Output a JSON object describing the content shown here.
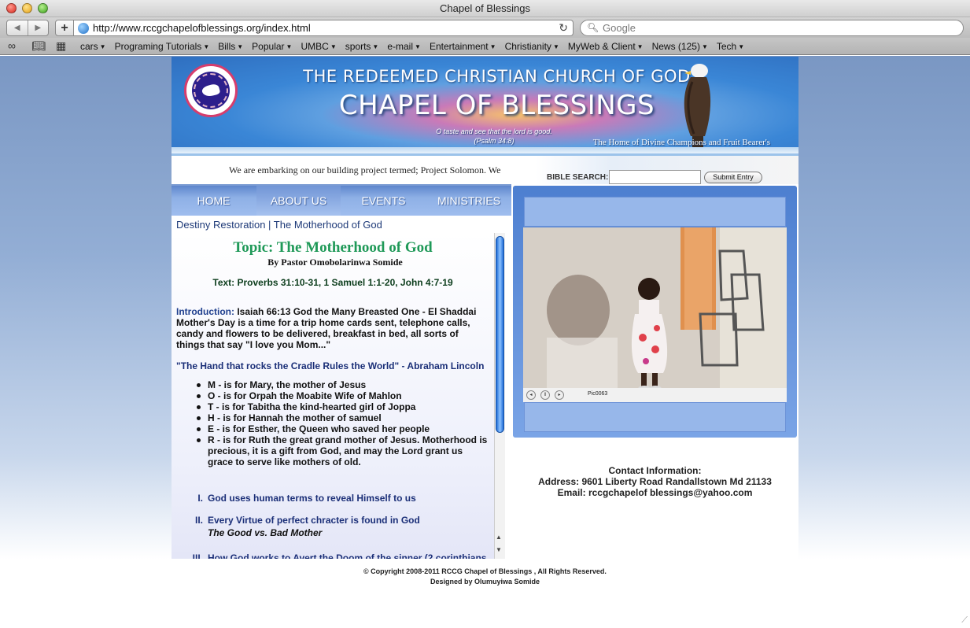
{
  "window": {
    "title": "Chapel of Blessings"
  },
  "toolbar": {
    "url": "http://www.rccgchapelofblessings.org/index.html",
    "search_placeholder": "Google"
  },
  "bookmarks": [
    {
      "label": "cars"
    },
    {
      "label": "Programing Tutorials"
    },
    {
      "label": "Bills"
    },
    {
      "label": "Popular"
    },
    {
      "label": "UMBC"
    },
    {
      "label": "sports"
    },
    {
      "label": "e-mail"
    },
    {
      "label": "Entertainment"
    },
    {
      "label": "Christianity"
    },
    {
      "label": "MyWeb & Client"
    },
    {
      "label": "News (125)"
    },
    {
      "label": "Tech"
    }
  ],
  "banner": {
    "logo_text": "THE REDEEMED CHRISTIAN CHURCH OF GOD",
    "church": "THE REDEEMED CHRISTIAN CHURCH OF GOD",
    "chapel": "CHAPEL OF BLESSINGS",
    "verse_line1": "O taste and see that the lord is good.",
    "verse_line2": "(Psalm 34:8)",
    "tagline": "The Home of Divine Champions and Fruit Bearer's"
  },
  "announcement": "We are embarking on our building project termed; Project Solomon. We",
  "bible_search": {
    "label": "BIBLE SEARCH:",
    "value": "",
    "button": "Submit Entry"
  },
  "nav": [
    {
      "label": "HOME",
      "active": false
    },
    {
      "label": "ABOUT US",
      "active": true
    },
    {
      "label": "EVENTS",
      "active": false
    },
    {
      "label": "MINISTRIES",
      "active": false
    }
  ],
  "breadcrumb": "Destiny Restoration | The Motherhood of God",
  "article": {
    "topic": "Topic: The Motherhood of God",
    "pastor": "By Pastor Omobolarinwa Somide",
    "text": "Text: Proverbs 31:10-31, 1 Samuel 1:1-20, John 4:7-19",
    "intro_lead": "Introduction:",
    "intro_body": " Isaiah 66:13 God the Many Breasted One - El Shaddai Mother's Day is a time for a trip home cards sent, telephone calls, candy and flowers to be delivered, breakfast in bed, all sorts of things that say \"I love you Mom...\"",
    "quote": "\"The Hand that rocks the Cradle Rules the World\" - Abraham Lincoln",
    "bullets": [
      "M - is for Mary, the mother of Jesus",
      "O - is for Orpah the Moabite Wife of Mahlon",
      "T - is for Tabitha the kind-hearted girl of Joppa",
      "H - is for Hannah the mother of samuel",
      "E - is for Esther, the Queen who saved her people",
      "R - is for Ruth the great grand mother of Jesus. Motherhood is precious, it is a gift from God, and may the Lord grant us grace to serve like mothers of old."
    ],
    "points": [
      {
        "num": "I.",
        "text": "God uses human terms to reveal Himself to us"
      },
      {
        "num": "II.",
        "text": "Every Virtue of perfect chracter is found in God"
      },
      {
        "num": "III.",
        "text": "How God works to Avert the Doom of the sinner (2 corinthians"
      }
    ],
    "subheading": "The Good vs. Bad Mother"
  },
  "gallery": {
    "caption": "Pic0063"
  },
  "contact": {
    "heading": "Contact Information:",
    "address": "Address: 9601 Liberty Road Randallstown Md 21133",
    "email": "Email: rccgchapelof blessings@yahoo.com"
  },
  "footer": {
    "copyright": "© Copyright 2008-2011 RCCG Chapel of Blessings , All Rights Reserved.",
    "designer": "Designed by Olumuyiwa Somide"
  }
}
